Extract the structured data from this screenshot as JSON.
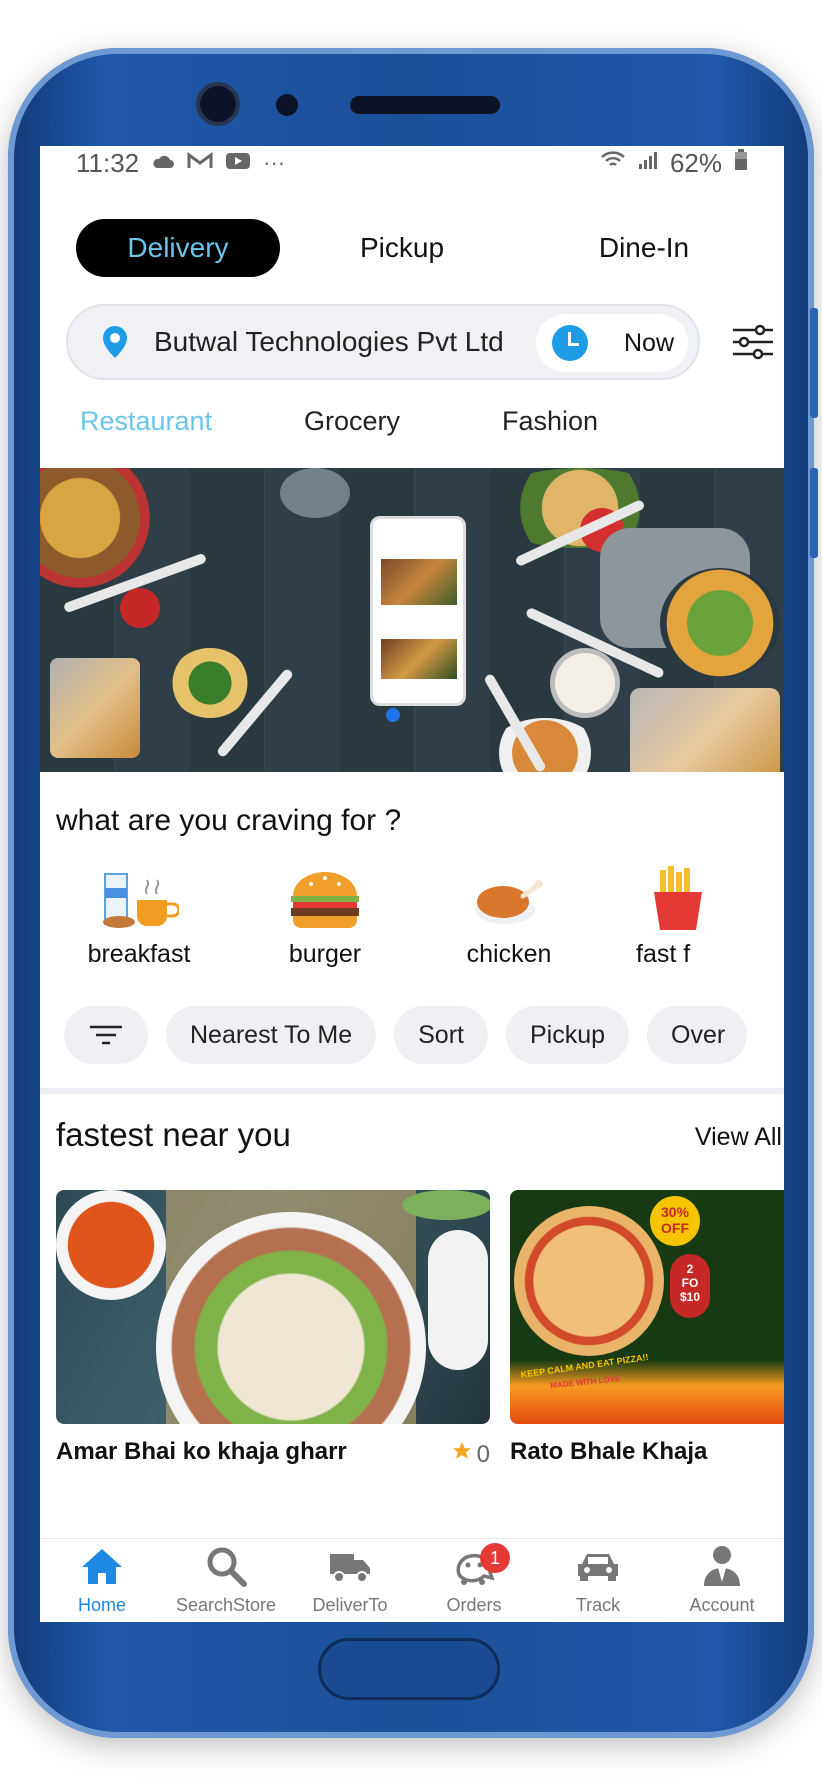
{
  "status_bar": {
    "time": "11:32",
    "more": "···",
    "battery": "62%"
  },
  "mode_tabs": [
    {
      "label": "Delivery",
      "active": true
    },
    {
      "label": "Pickup",
      "active": false
    },
    {
      "label": "Dine-In",
      "active": false
    }
  ],
  "location": {
    "address": "Butwal Technologies Pvt Ltd",
    "time_label": "Now"
  },
  "categories": [
    {
      "label": "Restaurant",
      "active": true
    },
    {
      "label": "Grocery",
      "active": false
    },
    {
      "label": "Fashion",
      "active": false
    }
  ],
  "craving": {
    "title": "what are you craving for ?",
    "items": [
      {
        "label": "breakfast",
        "icon": "breakfast-icon"
      },
      {
        "label": "burger",
        "icon": "burger-icon"
      },
      {
        "label": "chicken",
        "icon": "chicken-icon"
      },
      {
        "label": "fast f",
        "icon": "fries-icon"
      }
    ]
  },
  "chips": [
    "Nearest To Me",
    "Sort",
    "Pickup",
    "Over"
  ],
  "fastest": {
    "title": "fastest near you",
    "view_all": "View All",
    "stores": [
      {
        "name": "Amar Bhai ko khaja gharr",
        "rating": "0"
      },
      {
        "name": "Rato Bhale Khaja"
      }
    ],
    "promo": {
      "line1": "30%",
      "line2": "OFF",
      "line3": "2",
      "line4": "FO",
      "line5": "$10",
      "arc": "KEEP CALM AND EAT PIZZA!!",
      "sub": "MADE WITH LOVE"
    }
  },
  "tabbar": [
    {
      "label": "Home",
      "icon": "home-icon",
      "active": true
    },
    {
      "label": "SearchStore",
      "icon": "search-icon",
      "active": false
    },
    {
      "label": "DeliverTo",
      "icon": "delivery-truck-icon",
      "active": false
    },
    {
      "label": "Orders",
      "icon": "orders-icon",
      "active": false,
      "badge": "1"
    },
    {
      "label": "Track",
      "icon": "car-icon",
      "active": false
    },
    {
      "label": "Account",
      "icon": "account-icon",
      "active": false
    }
  ],
  "colors": {
    "accent": "#6bc5ea",
    "active_tab": "#1e88e5",
    "badge": "#e53935",
    "phone_body": "#1c4f98"
  }
}
